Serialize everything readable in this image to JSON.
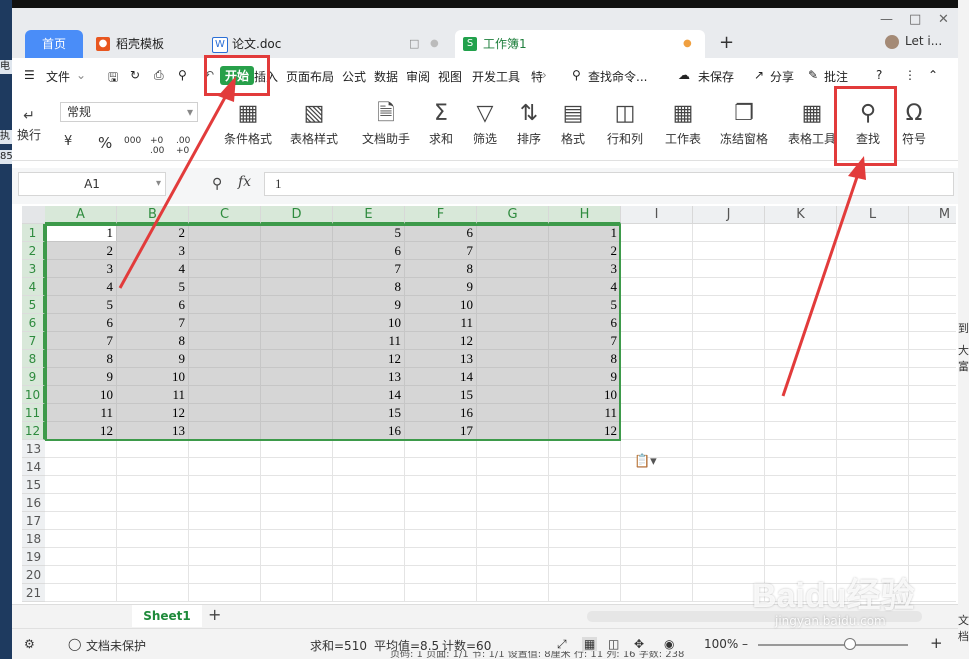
{
  "tabs": [
    {
      "label": "首页"
    },
    {
      "label": "稻壳模板"
    },
    {
      "label": "论文.doc"
    },
    {
      "label": "工作簿1"
    }
  ],
  "user": {
    "name": "Let i..."
  },
  "menu": {
    "file": "文件",
    "items": [
      "开始",
      "插入",
      "页面布局",
      "公式",
      "数据",
      "审阅",
      "视图",
      "开发工具",
      "特"
    ],
    "search": "查找命令...",
    "unsaved": "未保存",
    "share": "分享",
    "comment": "批注",
    "help": "?"
  },
  "ribbon": {
    "wrap": "换行",
    "number_format": "常规",
    "currency": "¥",
    "percent": "%",
    "thousands": "000",
    "inc_decimal": "+0 .00",
    "dec_decimal": ".00 +0",
    "buttons": [
      "条件格式",
      "表格样式",
      "文档助手",
      "求和",
      "筛选",
      "排序",
      "格式",
      "行和列",
      "工作表",
      "冻结窗格",
      "表格工具",
      "查找",
      "符号"
    ]
  },
  "formula": {
    "cell_ref": "A1",
    "fx": "fx",
    "value": "1"
  },
  "grid": {
    "columns": [
      "A",
      "B",
      "C",
      "D",
      "E",
      "F",
      "G",
      "H",
      "I",
      "J",
      "K",
      "L",
      "M"
    ],
    "rows": [
      "1",
      "2",
      "3",
      "4",
      "5",
      "6",
      "7",
      "8",
      "9",
      "10",
      "11",
      "12",
      "13",
      "14",
      "15",
      "16",
      "17",
      "18",
      "19",
      "20",
      "21"
    ],
    "data": [
      [
        "1",
        "2",
        "",
        "",
        "5",
        "6",
        "",
        "1"
      ],
      [
        "2",
        "3",
        "",
        "",
        "6",
        "7",
        "",
        "2"
      ],
      [
        "3",
        "4",
        "",
        "",
        "7",
        "8",
        "",
        "3"
      ],
      [
        "4",
        "5",
        "",
        "",
        "8",
        "9",
        "",
        "4"
      ],
      [
        "5",
        "6",
        "",
        "",
        "9",
        "10",
        "",
        "5"
      ],
      [
        "6",
        "7",
        "",
        "",
        "10",
        "11",
        "",
        "6"
      ],
      [
        "7",
        "8",
        "",
        "",
        "11",
        "12",
        "",
        "7"
      ],
      [
        "8",
        "9",
        "",
        "",
        "12",
        "13",
        "",
        "8"
      ],
      [
        "9",
        "10",
        "",
        "",
        "13",
        "14",
        "",
        "9"
      ],
      [
        "10",
        "11",
        "",
        "",
        "14",
        "15",
        "",
        "10"
      ],
      [
        "11",
        "12",
        "",
        "",
        "15",
        "16",
        "",
        "11"
      ],
      [
        "12",
        "13",
        "",
        "",
        "16",
        "17",
        "",
        "12"
      ]
    ]
  },
  "sheets": [
    "Sheet1"
  ],
  "status": {
    "protect": "文档未保护",
    "sum": "求和=510",
    "average": "平均值=8.5",
    "count": "计数=60",
    "zoom": "100%"
  },
  "watermark": {
    "brand": "Baidu经验",
    "url": "jingyan.baidu.com"
  },
  "bottom_strip": "页码: 1   页面: 1/1   节: 1/1   设置值: 8厘米   行: 11   列: 16   字数: 238",
  "desktop_fragments": {
    "left": [
      "电",
      "执",
      "85"
    ],
    "right": [
      "到,",
      "大富",
      "文档"
    ]
  },
  "colors": {
    "accent_green": "#3d9a4a",
    "highlight_red": "#e23b3b",
    "home_tab_blue": "#4a8df8"
  }
}
